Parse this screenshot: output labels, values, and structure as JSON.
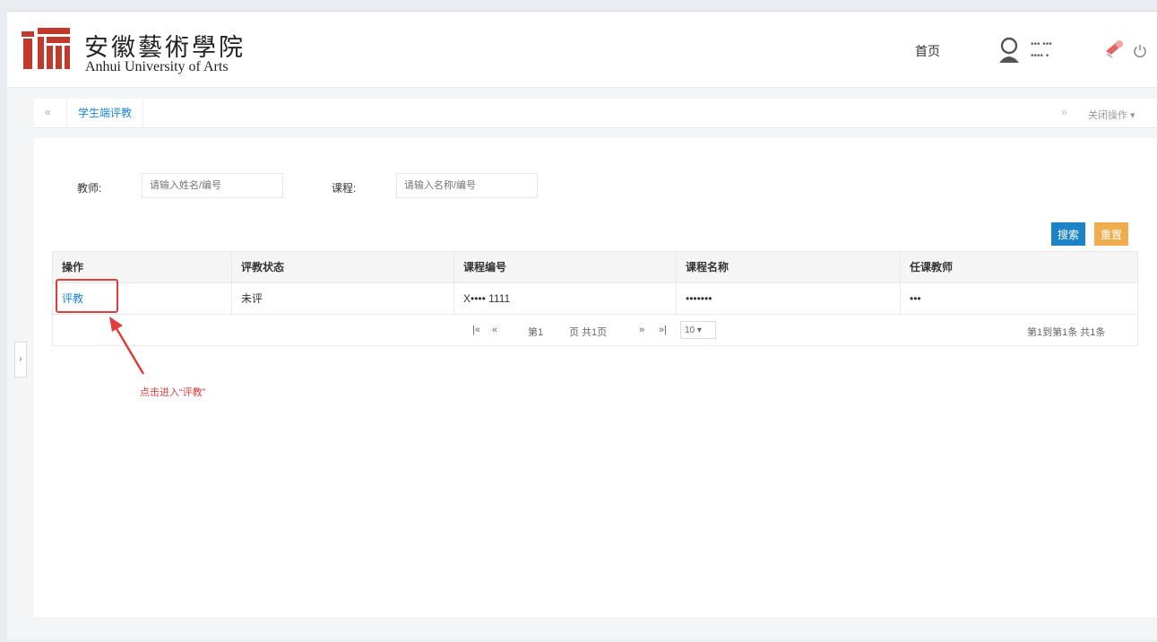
{
  "header": {
    "logo_cn": "安徽藝術學院",
    "logo_en": "Anhui University of Arts",
    "nav_home": "首页",
    "user_line1": "••• •••",
    "user_line2": "•••• •"
  },
  "tabs": {
    "active_label": "学生端评教",
    "back_symbol": "«",
    "forward_symbol": "»",
    "close_label": "关闭操作 ▾"
  },
  "filters": {
    "teacher_label": "教师:",
    "teacher_placeholder": "请输入姓名/编号",
    "course_label": "课程:",
    "course_placeholder": "请输入名称/编号"
  },
  "buttons": {
    "search": "搜索",
    "reset": "重置"
  },
  "table": {
    "columns": [
      "操作",
      "评教状态",
      "课程编号",
      "课程名称",
      "任课教师"
    ],
    "rows": [
      {
        "action": "评教",
        "status": "未评",
        "course_code": "X•••• 1111",
        "course_name": "•••••••",
        "teacher": "•••"
      }
    ]
  },
  "pager": {
    "first": "|«",
    "prev": "«",
    "page_prefix": "第1",
    "page_suffix": "页 共1页",
    "next": "»",
    "last": "»|",
    "page_size": "10 ▾",
    "summary": "第1到第1条 共1条"
  },
  "annotation": {
    "text": "点击进入“评教”"
  },
  "sidebar": {
    "toggle_symbol": "›"
  },
  "colors": {
    "accent_blue": "#1c84c6",
    "reset_orange": "#f0ad4e",
    "annotation_red": "#e23c3c",
    "logo_red": "#c0392b"
  }
}
